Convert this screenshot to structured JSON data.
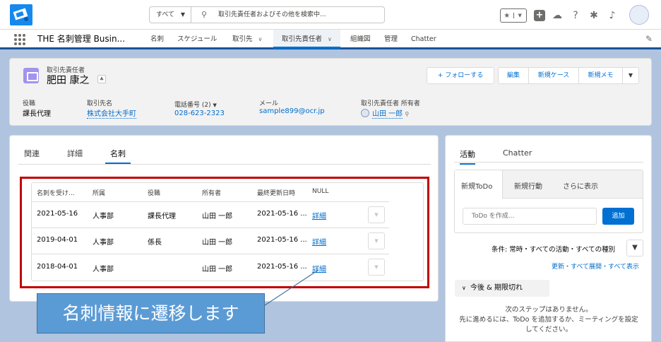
{
  "header": {
    "scope": "すべて",
    "search_placeholder": "取引先責任者およびその他を検索中..."
  },
  "nav": {
    "app_name": "THE 名刺管理 Busin...",
    "items": [
      "名刺",
      "スケジュール",
      "取引先",
      "取引先責任者",
      "組織図",
      "管理",
      "Chatter"
    ]
  },
  "record": {
    "type": "取引先責任者",
    "name": "肥田 康之",
    "buttons": [
      "+ フォローする",
      "編集",
      "新規ケース",
      "新規メモ"
    ],
    "fields": [
      {
        "label": "役職",
        "value": "課長代理"
      },
      {
        "label": "取引先名",
        "value": "株式会社大手町"
      },
      {
        "label": "電話番号 (2)",
        "value": "028-623-2323"
      },
      {
        "label": "メール",
        "value": "sample899@ocr.jp"
      },
      {
        "label": "取引先責任者 所有者",
        "value": "山田 一郎"
      }
    ]
  },
  "left": {
    "tabs": [
      "関連",
      "詳細",
      "名刺"
    ],
    "columns": [
      "名刺を受け...",
      "所属",
      "役職",
      "所有者",
      "最終更新日時",
      "NULL"
    ],
    "rows": [
      [
        "2021-05-16",
        "人事部",
        "課長代理",
        "山田 一郎",
        "2021-05-16 ...",
        "詳細"
      ],
      [
        "2019-04-01",
        "人事部",
        "係長",
        "山田 一郎",
        "2021-05-16 ...",
        "詳細"
      ],
      [
        "2018-04-01",
        "人事部",
        "",
        "山田 一郎",
        "2021-05-16 ...",
        "詳細"
      ]
    ]
  },
  "callout": "名刺情報に遷移します",
  "right": {
    "tabs": [
      "活動",
      "Chatter"
    ],
    "subtabs": [
      "新規ToDo",
      "新規行動",
      "さらに表示"
    ],
    "todo_placeholder": "ToDo を作成...",
    "add_label": "追加",
    "filter_text": "条件: 常時・すべての活動・すべての種別",
    "links": "更新・すべて展開・すべて表示",
    "section": "今後 & 期限切れ",
    "no_steps_1": "次のステップはありません。",
    "no_steps_2": "先に進めるには、ToDo を追加するか、ミーティングを設定",
    "no_steps_3": "してください。"
  },
  "colors": {
    "brand": "#0070d2",
    "nav_accent": "#1b5297",
    "callout": "#5b9bd5",
    "highlight": "#c00000"
  }
}
